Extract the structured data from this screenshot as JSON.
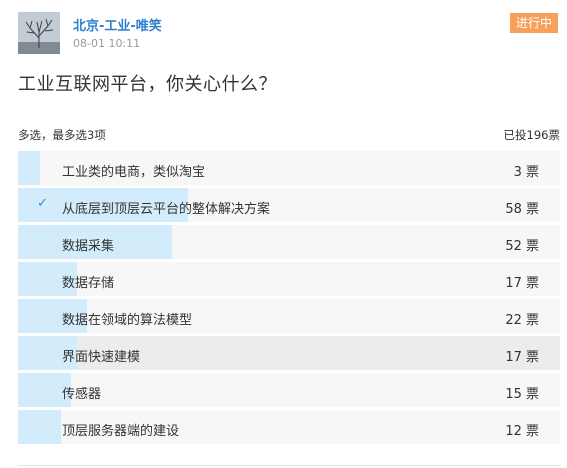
{
  "post": {
    "author": "北京-工业-唯笑",
    "time": "08-01 10:11",
    "status": "进行中",
    "question": "工业互联网平台，你关心什么？"
  },
  "poll": {
    "rule": "多选，最多选3项",
    "total": "已投196票",
    "options": [
      {
        "label": "工业类的电商，类似淘宝",
        "votes": "3 票",
        "share": 0.02,
        "selected": false
      },
      {
        "label": "从底层到顶层云平台的整体解决方案",
        "votes": "58 票",
        "share": 0.3,
        "selected": true
      },
      {
        "label": "数据采集",
        "votes": "52 票",
        "share": 0.27,
        "selected": false
      },
      {
        "label": "数据存储",
        "votes": "17 票",
        "share": 0.09,
        "selected": false
      },
      {
        "label": "数据在领域的算法模型",
        "votes": "22 票",
        "share": 0.11,
        "selected": false
      },
      {
        "label": "界面快速建模",
        "votes": "17 票",
        "share": 0.09,
        "selected": false
      },
      {
        "label": "传感器",
        "votes": "15 票",
        "share": 0.08,
        "selected": false
      },
      {
        "label": "顶层服务器端的建设",
        "votes": "12 票",
        "share": 0.06,
        "selected": false
      }
    ]
  },
  "colors": {
    "author": "#2b7fd0",
    "status_badge": "#f7a05c",
    "bar_fill": "#d2ecfb",
    "check": "#2b8fe0"
  },
  "icons": {
    "avatar": "tree-landscape-photo",
    "selected_mark": "checkmark-icon"
  }
}
